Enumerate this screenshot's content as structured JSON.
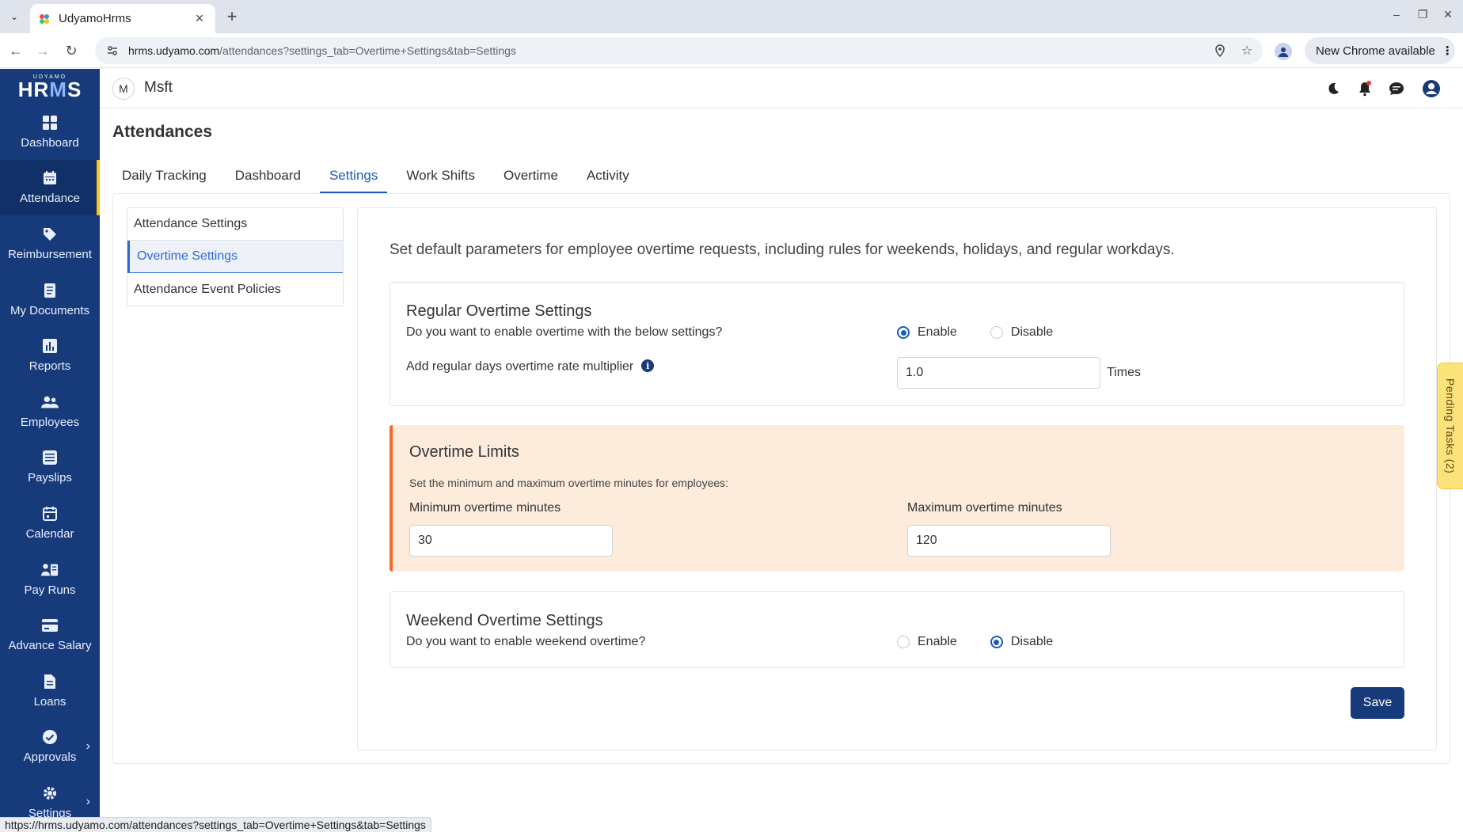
{
  "browser": {
    "tab_title": "UdyamoHrms",
    "url_host": "hrms.udyamo.com",
    "url_path": "/attendances?settings_tab=Overtime+Settings&tab=Settings",
    "update_label": "New Chrome available",
    "status_url": "https://hrms.udyamo.com/attendances?settings_tab=Overtime+Settings&tab=Settings"
  },
  "logo": {
    "small": "UDYAMO",
    "big_a": "HR",
    "big_b": "M",
    "big_c": "S"
  },
  "sidebar": {
    "items": [
      {
        "label": "Dashboard",
        "icon": "dashboard-grid-icon"
      },
      {
        "label": "Attendance",
        "icon": "calendar-icon"
      },
      {
        "label": "Reimbursement",
        "icon": "tag-icon"
      },
      {
        "label": "My Documents",
        "icon": "document-icon"
      },
      {
        "label": "Reports",
        "icon": "bar-chart-icon"
      },
      {
        "label": "Employees",
        "icon": "users-icon"
      },
      {
        "label": "Payslips",
        "icon": "inbox-icon"
      },
      {
        "label": "Calendar",
        "icon": "calendar-icon"
      },
      {
        "label": "Pay Runs",
        "icon": "pay-runs-icon"
      },
      {
        "label": "Advance Salary",
        "icon": "card-icon"
      },
      {
        "label": "Loans",
        "icon": "document-icon"
      },
      {
        "label": "Approvals",
        "icon": "check-circle-icon"
      },
      {
        "label": "Settings",
        "icon": "gear-icon"
      }
    ]
  },
  "header": {
    "org_initial": "M",
    "org_name": "Msft"
  },
  "page": {
    "title": "Attendances",
    "tabs": [
      "Daily Tracking",
      "Dashboard",
      "Settings",
      "Work Shifts",
      "Overtime",
      "Activity"
    ]
  },
  "subnav": [
    "Attendance Settings",
    "Overtime Settings",
    "Attendance Event Policies"
  ],
  "overtime": {
    "intro": "Set default parameters for employee overtime requests, including rules for weekends, holidays, and regular workdays.",
    "regular": {
      "title": "Regular Overtime Settings",
      "question": "Do you want to enable overtime with the below settings?",
      "enable_label": "Enable",
      "disable_label": "Disable",
      "multiplier_label": "Add regular days overtime rate multiplier",
      "multiplier_value": "1.0",
      "times_label": "Times"
    },
    "limits": {
      "title": "Overtime Limits",
      "description": "Set the minimum and maximum overtime minutes for employees:",
      "min_label": "Minimum overtime minutes",
      "min_value": "30",
      "max_label": "Maximum overtime minutes",
      "max_value": "120"
    },
    "weekend": {
      "title": "Weekend Overtime Settings",
      "question": "Do you want to enable weekend overtime?",
      "enable_label": "Enable",
      "disable_label": "Disable"
    },
    "save_label": "Save"
  },
  "pending_tasks": "Pending Tasks (2)",
  "colors": {
    "sidebar": "#173a7a",
    "accent": "#1e5bb8",
    "limits_bg": "#fdebdc",
    "limits_border": "#f26b2a"
  }
}
